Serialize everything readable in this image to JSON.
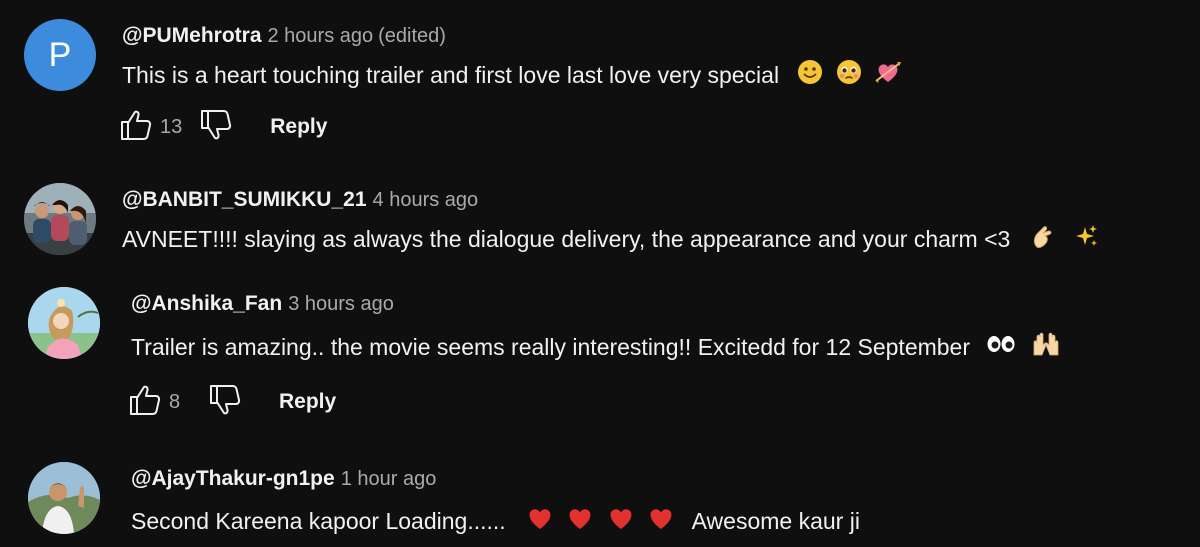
{
  "comments": [
    {
      "author": "@PUMehrotra",
      "time": "2 hours ago",
      "edited": "(edited)",
      "avatar_letter": "P",
      "avatar_color": "#3d8bdc",
      "text": "This is a heart touching trailer and first love last love very special",
      "emojis": [
        "slightly-smiling-face",
        "pleading-face",
        "heart-with-arrow"
      ],
      "likes": "13",
      "reply_label": "Reply"
    },
    {
      "author": "@BANBIT_SUMIKKU_21",
      "time": "4 hours ago",
      "avatar": "group-photo",
      "text": "AVNEET!!!! slaying as always the dialogue delivery, the appearance and your charm <3",
      "emojis": [
        "pinching-hand",
        "sparkles"
      ]
    },
    {
      "author": "@Anshika_Fan",
      "time": "3 hours ago",
      "avatar": "illustrated-girl",
      "text": "Trailer is amazing.. the movie seems really interesting!! Excitedd for 12 September",
      "emojis": [
        "eyes",
        "raising-hands"
      ],
      "likes": "8",
      "reply_label": "Reply"
    },
    {
      "author": "@AjayThakur-gn1pe",
      "time": "1 hour ago",
      "avatar": "man-photo",
      "text": "Second Kareena kapoor Loading......",
      "emojis": [
        "red-heart",
        "red-heart",
        "red-heart",
        "red-heart"
      ],
      "text_after": "Awesome kaur ji"
    }
  ],
  "colors": {
    "background": "#0f0f0f",
    "primary_text": "#f1f1f1",
    "secondary_text": "#aaaaaa"
  }
}
